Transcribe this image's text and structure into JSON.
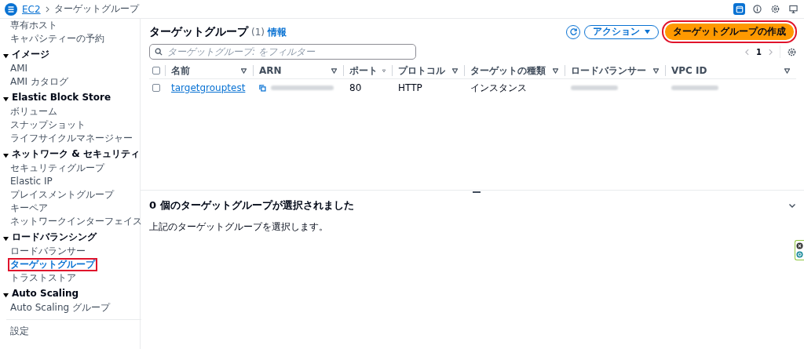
{
  "breadcrumb": [
    {
      "label": "EC2",
      "link": true
    },
    {
      "label": "ターゲットグループ",
      "link": false
    }
  ],
  "top_icons": [
    {
      "kind": "panel",
      "selected": true
    },
    {
      "kind": "info",
      "selected": false
    },
    {
      "kind": "gear",
      "selected": false
    },
    {
      "kind": "monitor",
      "selected": false
    }
  ],
  "sidebar": {
    "items": [
      {
        "kind": "item",
        "label": "専有ホスト",
        "selected": false,
        "highlighted": false
      },
      {
        "kind": "item",
        "label": "キャパシティーの予約",
        "selected": false,
        "highlighted": false
      },
      {
        "kind": "header",
        "label": "イメージ",
        "expanded": true
      },
      {
        "kind": "item",
        "label": "AMI",
        "selected": false,
        "highlighted": false
      },
      {
        "kind": "item",
        "label": "AMI カタログ",
        "selected": false,
        "highlighted": false
      },
      {
        "kind": "header",
        "label": "Elastic Block Store",
        "expanded": true
      },
      {
        "kind": "item",
        "label": "ボリューム",
        "selected": false,
        "highlighted": false
      },
      {
        "kind": "item",
        "label": "スナップショット",
        "selected": false,
        "highlighted": false
      },
      {
        "kind": "item",
        "label": "ライフサイクルマネージャー",
        "selected": false,
        "highlighted": false
      },
      {
        "kind": "header",
        "label": "ネットワーク & セキュリティ",
        "expanded": true
      },
      {
        "kind": "item",
        "label": "セキュリティグループ",
        "selected": false,
        "highlighted": false
      },
      {
        "kind": "item",
        "label": "Elastic IP",
        "selected": false,
        "highlighted": false
      },
      {
        "kind": "item",
        "label": "プレイスメントグループ",
        "selected": false,
        "highlighted": false
      },
      {
        "kind": "item",
        "label": "キーペア",
        "selected": false,
        "highlighted": false
      },
      {
        "kind": "item",
        "label": "ネットワークインターフェイス",
        "selected": false,
        "highlighted": false
      },
      {
        "kind": "header",
        "label": "ロードバランシング",
        "expanded": true
      },
      {
        "kind": "item",
        "label": "ロードバランサー",
        "selected": false,
        "highlighted": false
      },
      {
        "kind": "item",
        "label": "ターゲットグループ",
        "selected": true,
        "highlighted": true
      },
      {
        "kind": "item",
        "label": "トラストストア",
        "selected": false,
        "highlighted": false
      },
      {
        "kind": "header",
        "label": "Auto Scaling",
        "expanded": true
      },
      {
        "kind": "item",
        "label": "Auto Scaling グループ",
        "selected": false,
        "highlighted": false
      },
      {
        "kind": "divider"
      },
      {
        "kind": "item",
        "label": "設定",
        "selected": false,
        "highlighted": false
      }
    ]
  },
  "panel": {
    "title": "ターゲットグループ",
    "count": "(1)",
    "info": "情報",
    "actions": "アクション",
    "create": {
      "label": "ターゲットグループの作成",
      "highlighted": true
    },
    "search": {
      "placeholder": "ターゲットグループ: をフィルター"
    },
    "page": "1"
  },
  "table": {
    "all_checked": false,
    "columns": [
      "名前",
      "ARN",
      "ポート",
      "プロトコル",
      "ターゲットの種類",
      "ロードバランサー",
      "VPC ID"
    ],
    "rows": [
      {
        "checked": false,
        "cells": [
          {
            "kind": "link",
            "text": "targetgrouptest"
          },
          {
            "kind": "redacted-copy"
          },
          {
            "kind": "text",
            "text": "80"
          },
          {
            "kind": "text",
            "text": "HTTP"
          },
          {
            "kind": "text",
            "text": "インスタンス"
          },
          {
            "kind": "redacted"
          },
          {
            "kind": "redacted"
          }
        ]
      }
    ]
  },
  "details": {
    "title": "0 個のターゲットグループが選択されました",
    "hint": "上記のターゲットグループを選択します。",
    "expanded": false
  }
}
